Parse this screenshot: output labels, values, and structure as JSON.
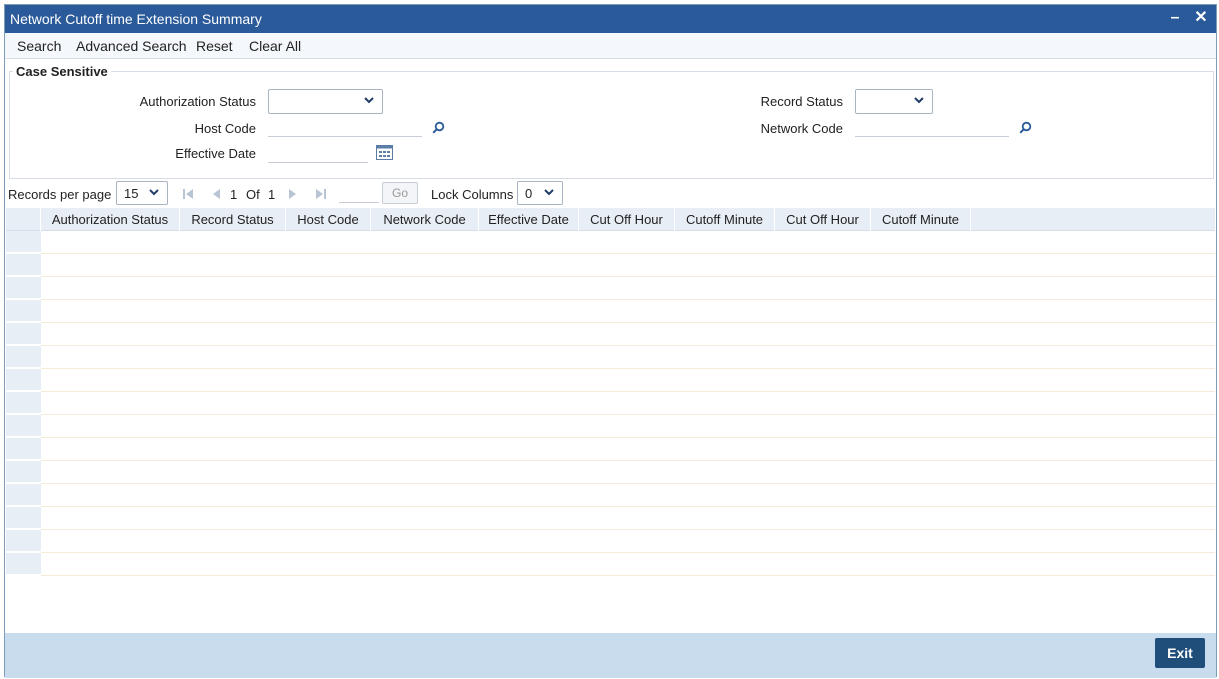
{
  "window": {
    "title": "Network Cutoff time Extension Summary",
    "minimize_glyph": "–",
    "close_glyph": "✕"
  },
  "toolbar": {
    "search": "Search",
    "advanced_search": "Advanced Search",
    "reset": "Reset",
    "clear_all": "Clear All"
  },
  "criteria": {
    "legend": "Case Sensitive",
    "authorization_status_label": "Authorization Status",
    "record_status_label": "Record Status",
    "host_code_label": "Host Code",
    "network_code_label": "Network Code",
    "effective_date_label": "Effective Date"
  },
  "pager": {
    "records_per_page_label": "Records per page",
    "records_per_page_value": "15",
    "current_page": "1",
    "of_label": "Of",
    "total_pages": "1",
    "go_label": "Go",
    "lock_columns_label": "Lock Columns",
    "lock_columns_value": "0"
  },
  "grid": {
    "columns": [
      "Authorization Status",
      "Record Status",
      "Host Code",
      "Network Code",
      "Effective Date",
      "Cut Off Hour",
      "Cutoff Minute",
      "Cut Off Hour",
      "Cutoff Minute"
    ],
    "row_count": 15
  },
  "footer": {
    "exit_label": "Exit"
  },
  "colors": {
    "titlebar": "#2a5a99",
    "footer": "#c8dcee",
    "exit_button": "#1f4e7a",
    "grid_header": "#e8eef6"
  },
  "icons": [
    "search-icon",
    "calendar-icon",
    "chevron-down-icon",
    "first-page-icon",
    "prev-page-icon",
    "next-page-icon",
    "last-page-icon"
  ]
}
